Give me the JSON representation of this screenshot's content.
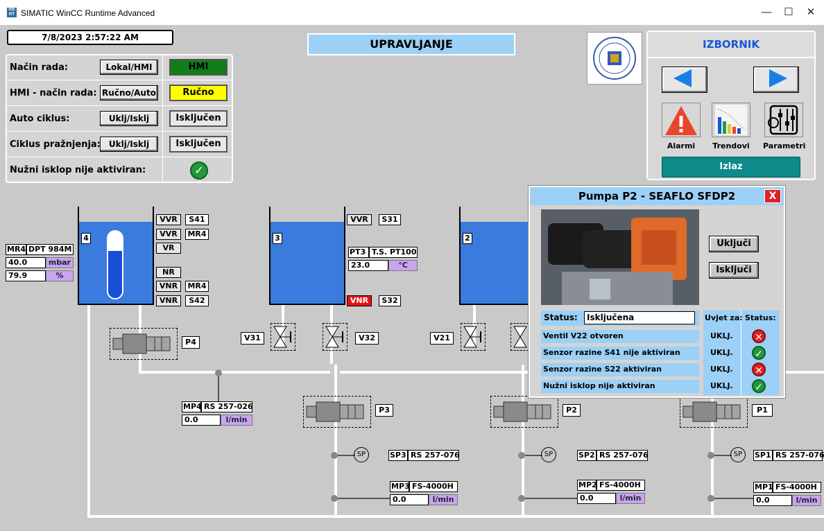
{
  "window": {
    "title": "SIMATIC WinCC Runtime Advanced",
    "app_icon_text": "SIE RT",
    "minimize": "—",
    "maximize": "☐",
    "close": "✕"
  },
  "datetime": "7/8/2023 2:57:22 AM",
  "header_title": "UPRAVLJANJE",
  "control": {
    "rows": [
      {
        "label": "Način rada:",
        "button": "Lokal/HMI",
        "state": "HMI",
        "state_color": "#0f7d18",
        "state_text_color": "#000000"
      },
      {
        "label": "HMI - način rada:",
        "button": "Ručno/Auto",
        "state": "Ručno",
        "state_color": "#ffff00",
        "state_text_color": "#000000"
      },
      {
        "label": "Auto ciklus:",
        "button": "Uklj/Isklj",
        "state": "Isključen",
        "state_color": "#e8e8e8",
        "state_text_color": "#000000"
      },
      {
        "label": "Ciklus pražnjenja:",
        "button": "Uklj/Isklj",
        "state": "Isključen",
        "state_color": "#e8e8e8",
        "state_text_color": "#000000"
      }
    ],
    "estop_label": "Nužni isklop nije aktiviran:",
    "estop_icon": "check-icon"
  },
  "menu": {
    "title": "IZBORNIK",
    "prev_icon": "arrow-left-icon",
    "next_icon": "arrow-right-icon",
    "items": [
      {
        "label": "Alarmi",
        "icon": "alarm-icon"
      },
      {
        "label": "Trendovi",
        "icon": "trend-icon"
      },
      {
        "label": "Parametri",
        "icon": "parameters-icon"
      }
    ],
    "exit": "Izlaz"
  },
  "logo_icon": "university-seal-logo",
  "tanks": {
    "t4": {
      "number": "4",
      "tags": [
        "VVR",
        "S41",
        "VVR",
        "MR4",
        "VR",
        "NR",
        "VNR",
        "MR4",
        "VNR",
        "S42"
      ],
      "sensor": {
        "id": "MR4",
        "model": "DPT 984M",
        "value1": "40.0",
        "unit1": "mbar",
        "value2": "79.9",
        "unit2": "%"
      }
    },
    "t3": {
      "number": "3",
      "tags": [
        "VVR",
        "S31",
        "VNR",
        "S32"
      ],
      "sensor": {
        "id": "PT3",
        "model": "T.S. PT100",
        "value": "23.0",
        "unit": "°C"
      }
    },
    "t2": {
      "number": "2"
    }
  },
  "valves": [
    "V31",
    "V32",
    "V21"
  ],
  "pumps": [
    "P4",
    "P3",
    "P2",
    "P1"
  ],
  "flow4": {
    "id": "MP4",
    "model": "RS 257-026",
    "value": "0.0",
    "unit": "l/min"
  },
  "sp": [
    {
      "circle": "SP",
      "id": "SP3",
      "model": "RS 257-076"
    },
    {
      "circle": "SP",
      "id": "SP2",
      "model": "RS 257-076"
    },
    {
      "circle": "SP",
      "id": "SP1",
      "model": "RS 257-076"
    }
  ],
  "mp": [
    {
      "id": "MP3",
      "model": "FS-4000H",
      "value": "0.0",
      "unit": "l/min"
    },
    {
      "id": "MP2",
      "model": "FS-4000H",
      "value": "0.0",
      "unit": "l/min"
    },
    {
      "id": "MP1",
      "model": "FS-4000H",
      "value": "0.0",
      "unit": "l/min"
    }
  ],
  "popup": {
    "title": "Pumpa P2 - SEAFLO SFDP2",
    "close": "X",
    "on_button": "Uključi",
    "off_button": "Isključi",
    "status_label": "Status:",
    "status_value": "Isključena",
    "col_cond": "Uvjet za:",
    "col_status": "Status:",
    "conditions": [
      {
        "text": "Ventil V22 otvoren",
        "cond": "UKLJ.",
        "ok": false
      },
      {
        "text": "Senzor razine S41 nije aktiviran",
        "cond": "UKLJ.",
        "ok": true
      },
      {
        "text": "Senzor razine S22 aktiviran",
        "cond": "UKLJ.",
        "ok": false
      },
      {
        "text": "Nužni isklop nije aktiviran",
        "cond": "UKLJ.",
        "ok": true
      }
    ]
  },
  "colors": {
    "background": "#c9c9c9",
    "water": "#3b7bde",
    "header_title_bg": "#9cd0f6",
    "exit_bg": "#0e8a8a",
    "popup_bg": "#9cd0f6"
  }
}
